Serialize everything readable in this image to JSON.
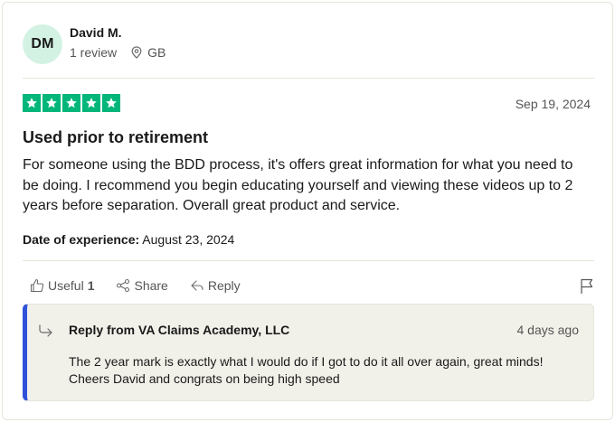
{
  "reviewer": {
    "initials": "DM",
    "name": "David M.",
    "reviews": "1 review",
    "country": "GB"
  },
  "review": {
    "rating": 5,
    "rating_color": "#00b67a",
    "date": "Sep 19, 2024",
    "title": "Used prior to retirement",
    "body": "For someone using the BDD process, it's offers great information for what you need to be doing. I recommend you begin educating yourself and viewing these videos up to 2 years before separation. Overall great product and service.",
    "date_of_experience_label": "Date of experience:",
    "date_of_experience": "August 23, 2024"
  },
  "actions": {
    "useful_label": "Useful",
    "useful_count": "1",
    "share_label": "Share",
    "reply_label": "Reply"
  },
  "reply": {
    "from": "Reply from VA Claims Academy, LLC",
    "time": "4 days ago",
    "text": "The 2 year mark is exactly what I would do if I got to do it all over again, great minds! Cheers David and congrats on being high speed",
    "accent_color": "#2f51d9"
  }
}
